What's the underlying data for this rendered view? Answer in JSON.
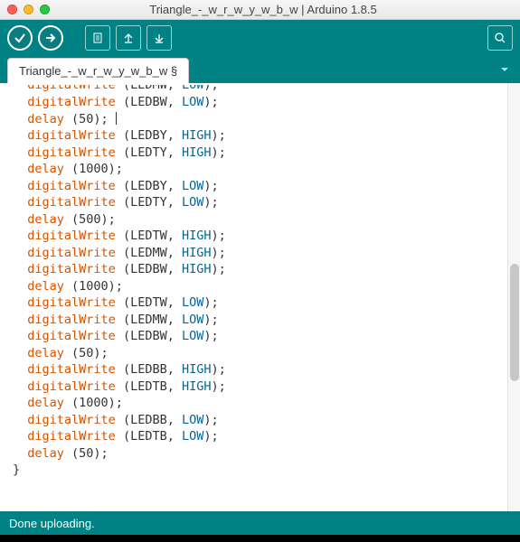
{
  "window": {
    "title": "Triangle_-_w_r_w_y_w_b_w | Arduino 1.8.5"
  },
  "tab": {
    "label": "Triangle_-_w_r_w_y_w_b_w §"
  },
  "status": {
    "text": "Done uploading."
  },
  "code": {
    "lines": [
      {
        "fn": "digitalWrite",
        "args": " (LEDMW, ",
        "const": "LOW",
        "tail": ");",
        "partial": true
      },
      {
        "fn": "digitalWrite",
        "args": " (LEDBW, ",
        "const": "LOW",
        "tail": ");"
      },
      {
        "fn": "delay",
        "args": " (50); ",
        "cursor": true
      },
      {
        "fn": "digitalWrite",
        "args": " (LEDBY, ",
        "const": "HIGH",
        "tail": ");"
      },
      {
        "fn": "digitalWrite",
        "args": " (LEDTY, ",
        "const": "HIGH",
        "tail": ");"
      },
      {
        "fn": "delay",
        "args": " (1000);"
      },
      {
        "fn": "digitalWrite",
        "args": " (LEDBY, ",
        "const": "LOW",
        "tail": ");"
      },
      {
        "fn": "digitalWrite",
        "args": " (LEDTY, ",
        "const": "LOW",
        "tail": ");"
      },
      {
        "fn": "delay",
        "args": " (500);"
      },
      {
        "fn": "digitalWrite",
        "args": " (LEDTW, ",
        "const": "HIGH",
        "tail": ");"
      },
      {
        "fn": "digitalWrite",
        "args": " (LEDMW, ",
        "const": "HIGH",
        "tail": ");"
      },
      {
        "fn": "digitalWrite",
        "args": " (LEDBW, ",
        "const": "HIGH",
        "tail": ");"
      },
      {
        "fn": "delay",
        "args": " (1000);"
      },
      {
        "fn": "digitalWrite",
        "args": " (LEDTW, ",
        "const": "LOW",
        "tail": ");"
      },
      {
        "fn": "digitalWrite",
        "args": " (LEDMW, ",
        "const": "LOW",
        "tail": ");"
      },
      {
        "fn": "digitalWrite",
        "args": " (LEDBW, ",
        "const": "LOW",
        "tail": ");"
      },
      {
        "fn": "delay",
        "args": " (50);"
      },
      {
        "fn": "digitalWrite",
        "args": " (LEDBB, ",
        "const": "HIGH",
        "tail": ");"
      },
      {
        "fn": "digitalWrite",
        "args": " (LEDTB, ",
        "const": "HIGH",
        "tail": ");"
      },
      {
        "fn": "delay",
        "args": " (1000);"
      },
      {
        "fn": "digitalWrite",
        "args": " (LEDBB, ",
        "const": "LOW",
        "tail": ");"
      },
      {
        "fn": "digitalWrite",
        "args": " (LEDTB, ",
        "const": "LOW",
        "tail": ");"
      },
      {
        "fn": "delay",
        "args": " (50);"
      }
    ],
    "closing": "}"
  }
}
